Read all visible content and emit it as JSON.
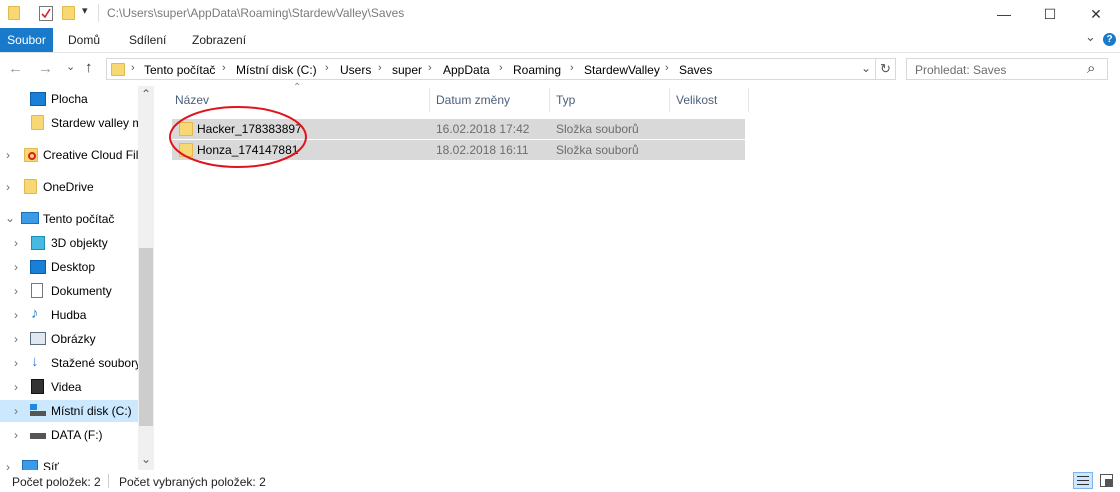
{
  "window": {
    "title": "C:\\Users\\super\\AppData\\Roaming\\StardewValley\\Saves",
    "controls": {
      "minimize": "—",
      "maximize": "☐",
      "close": "✕"
    }
  },
  "quick_access_icons": [
    "folder-icon",
    "properties-icon",
    "new-folder-icon",
    "customize-arrow-icon"
  ],
  "ribbon": {
    "tabs": [
      "Soubor",
      "Domů",
      "Sdílení",
      "Zobrazení"
    ],
    "expand_glyph": "⌄",
    "help_glyph": "?"
  },
  "address_bar": {
    "back": "←",
    "forward": "→",
    "recent": "⌄",
    "up": "↑",
    "breadcrumbs": [
      "Tento počítač",
      "Místní disk (C:)",
      "Users",
      "super",
      "AppData",
      "Roaming",
      "StardewValley",
      "Saves"
    ],
    "separator": "›",
    "dropdown": "⌄",
    "refresh": "↻"
  },
  "search": {
    "placeholder": "Prohledat: Saves",
    "icon": "⌕"
  },
  "nav_pane": {
    "items": [
      {
        "label": "Plocha",
        "icon": "desktop-icon",
        "indent": 1,
        "chevron": ""
      },
      {
        "label": "Stardew valley m",
        "icon": "folder-icon",
        "indent": 1,
        "chevron": ""
      },
      {
        "label": "Creative Cloud Fil",
        "icon": "creative-cloud-icon",
        "indent": 0,
        "chevron": "›"
      },
      {
        "label": "OneDrive",
        "icon": "folder-icon",
        "indent": 0,
        "chevron": "›"
      },
      {
        "label": "Tento počítač",
        "icon": "computer-icon",
        "indent": 0,
        "chevron": "⌄"
      },
      {
        "label": "3D objekty",
        "icon": "3d-objects-icon",
        "indent": 1,
        "chevron": "›"
      },
      {
        "label": "Desktop",
        "icon": "desktop-icon",
        "indent": 1,
        "chevron": "›"
      },
      {
        "label": "Dokumenty",
        "icon": "documents-icon",
        "indent": 1,
        "chevron": "›"
      },
      {
        "label": "Hudba",
        "icon": "music-icon",
        "indent": 1,
        "chevron": "›"
      },
      {
        "label": "Obrázky",
        "icon": "pictures-icon",
        "indent": 1,
        "chevron": "›"
      },
      {
        "label": "Stažené soubory",
        "icon": "downloads-icon",
        "indent": 1,
        "chevron": "›"
      },
      {
        "label": "Videa",
        "icon": "videos-icon",
        "indent": 1,
        "chevron": "›"
      },
      {
        "label": "Místní disk (C:)",
        "icon": "local-disk-icon",
        "indent": 1,
        "chevron": "›"
      },
      {
        "label": "DATA (F:)",
        "icon": "drive-icon",
        "indent": 1,
        "chevron": "›"
      },
      {
        "label": "Síť",
        "icon": "network-icon",
        "indent": 0,
        "chevron": "›"
      }
    ],
    "selected_index": 12,
    "scroll_up": "⌃",
    "scroll_down": "⌄"
  },
  "file_list": {
    "sort_glyph": "⌃",
    "columns": [
      "Název",
      "Datum změny",
      "Typ",
      "Velikost"
    ],
    "rows": [
      {
        "name": "Hacker_178383897",
        "date": "16.02.2018 17:42",
        "type": "Složka souborů",
        "size": ""
      },
      {
        "name": "Honza_174147881",
        "date": "18.02.2018 16:11",
        "type": "Složka souborů",
        "size": ""
      }
    ]
  },
  "status_bar": {
    "item_count": "Počet položek: 2",
    "selected_count": "Počet vybraných položek: 2"
  },
  "colors": {
    "accent": "#1979ca",
    "selection": "#d9d9d9",
    "annotation": "#e0141e"
  }
}
